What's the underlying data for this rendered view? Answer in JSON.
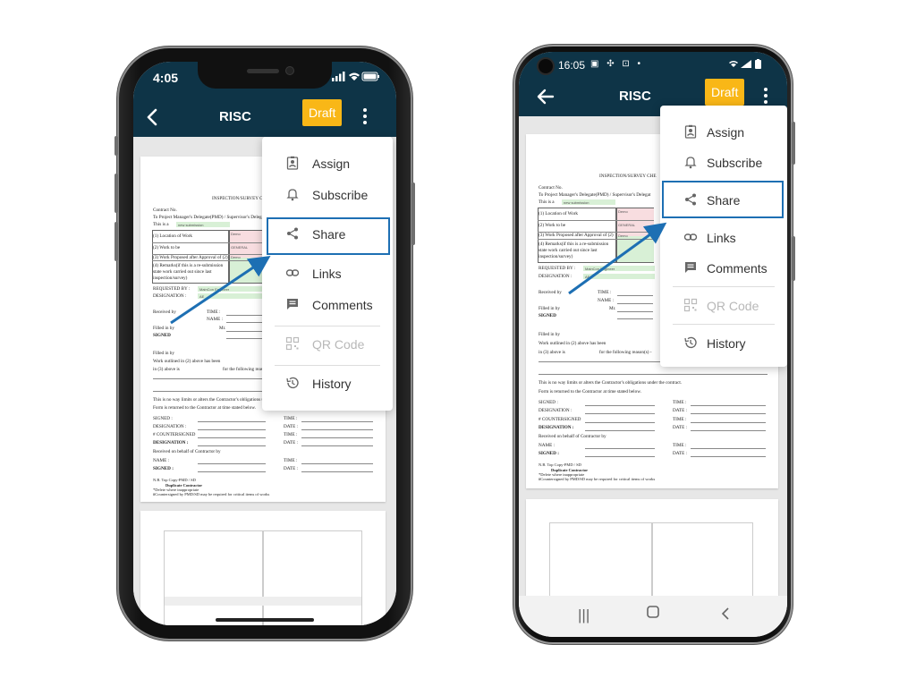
{
  "app": {
    "title": "RISC",
    "badge": "Draft"
  },
  "iphone": {
    "status_time": "4:05"
  },
  "android": {
    "status_time": "16:05"
  },
  "menu": {
    "items": [
      {
        "label": "Assign",
        "icon": "assign-icon",
        "enabled": true
      },
      {
        "label": "Subscribe",
        "icon": "bell-icon",
        "enabled": true
      },
      {
        "label": "Share",
        "icon": "share-icon",
        "enabled": true,
        "highlighted": true
      },
      {
        "label": "Links",
        "icon": "link-icon",
        "enabled": true
      },
      {
        "label": "Comments",
        "icon": "comment-icon",
        "enabled": true
      },
      {
        "label": "QR Code",
        "icon": "qr-code-icon",
        "enabled": false
      },
      {
        "label": "History",
        "icon": "history-icon",
        "enabled": true
      }
    ]
  },
  "document": {
    "heading": "INSPECTION/SURVEY CHE",
    "contract_no": "Contract No.",
    "to_line": "To Project Manager's Delegate(PMD) / Supervisor's Delegat",
    "this_is_a": "This is a",
    "submission_tag": "new submission",
    "rows": [
      "(1) Location of Work",
      "(2) Work to be",
      "(3) Work Proposed after Approval of (2)",
      "(4) Remarks(if this is a re-submission",
      "state work carried out since last",
      "inspection/survey)"
    ],
    "tag_demo": "Demo",
    "tag_general": "GENERAL",
    "tag_demo2": "Demo",
    "requested_by": "REQUESTED BY :",
    "requested_value": "MainCon Engineer",
    "designation": "DESIGNATION :",
    "designation_value": "AE",
    "received_by": "Received by",
    "time": "TIME :",
    "name": "NAME :",
    "filled_in_by": "Filled in by",
    "mr": "Mr.",
    "signed": "SIGNED",
    "filled_in_by2": "Filled in by",
    "work_outlined": "Work outlined in (2) above has been",
    "in3_above": "in (3) above is",
    "following_reasons": "for the following reason(s) -",
    "no_way": "This is no way limits or alters the Contractor's obligations under the contract.",
    "form_returned": "Form is returned to the Contractor at time stated below.",
    "signed_colon": "SIGNED :",
    "designation2": "DESIGNATION :",
    "countersigned": "# COUNTERSIGNED",
    "designation3": "DESIGNATION :",
    "received_behalf": "Received on behalf of Contractor by",
    "name2": "NAME :",
    "signed2": "SIGNED :",
    "date": "DATE :",
    "nb": "N.B. Top Copy-PMD / SD",
    "duplicate": "Duplicate  Contractor",
    "delete_where": "*Delete where inappropriate",
    "countersigned_note": "#Countersigned by PMD/SD may be required for critical items of works"
  },
  "colors": {
    "appbar": "#0e3447",
    "badge": "#f9b717",
    "highlight": "#1d6fb3"
  }
}
